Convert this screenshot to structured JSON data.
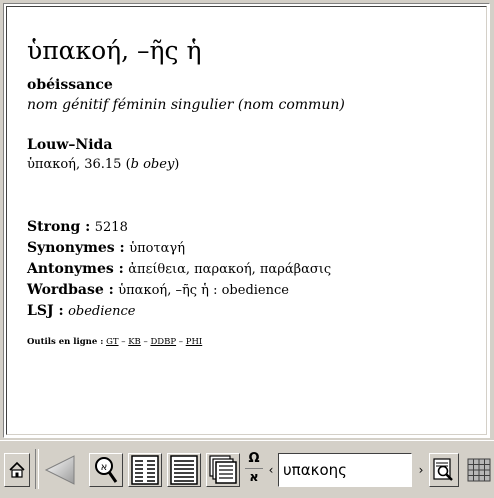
{
  "entry": {
    "headword": "ὑπακοή, –ῆς ἡ",
    "translation": "obéissance",
    "grammar": "nom génitif féminin singulier (nom commun)",
    "louw_nida_label": "Louw–Nida",
    "louw_nida_word": "ὑπακοή, 36.15 (",
    "louw_nida_gloss": "b obey",
    "louw_nida_close": ")",
    "strong_label": "Strong :",
    "strong_value": "5218",
    "synonyms_label": "Synonymes :",
    "synonyms_value": "ὑποταγή",
    "antonyms_label": "Antonymes :",
    "antonyms_value": "ἀπείθεια, παρακοή, παράβασις",
    "wordbase_label": "Wordbase :",
    "wordbase_value": "ὑπακοή, –ῆς ἡ : obedience",
    "lsj_label": "LSJ :",
    "lsj_value": "obedience",
    "tools_label": "Outils en ligne :",
    "tools_links": [
      "GT",
      "KB",
      "DDBP",
      "PHI"
    ],
    "tools_sep": "–"
  },
  "toolbar": {
    "search_value": "υπακοης",
    "omega_label": "Ω",
    "aleph_label": "א",
    "left_arrow": "‹",
    "right_arrow": "›",
    "icons": [
      "home-icon",
      "back-icon",
      "zoom-icon",
      "two-column-icon",
      "lines-icon",
      "windows-icon",
      "search-text-icon",
      "grid-icon"
    ]
  }
}
